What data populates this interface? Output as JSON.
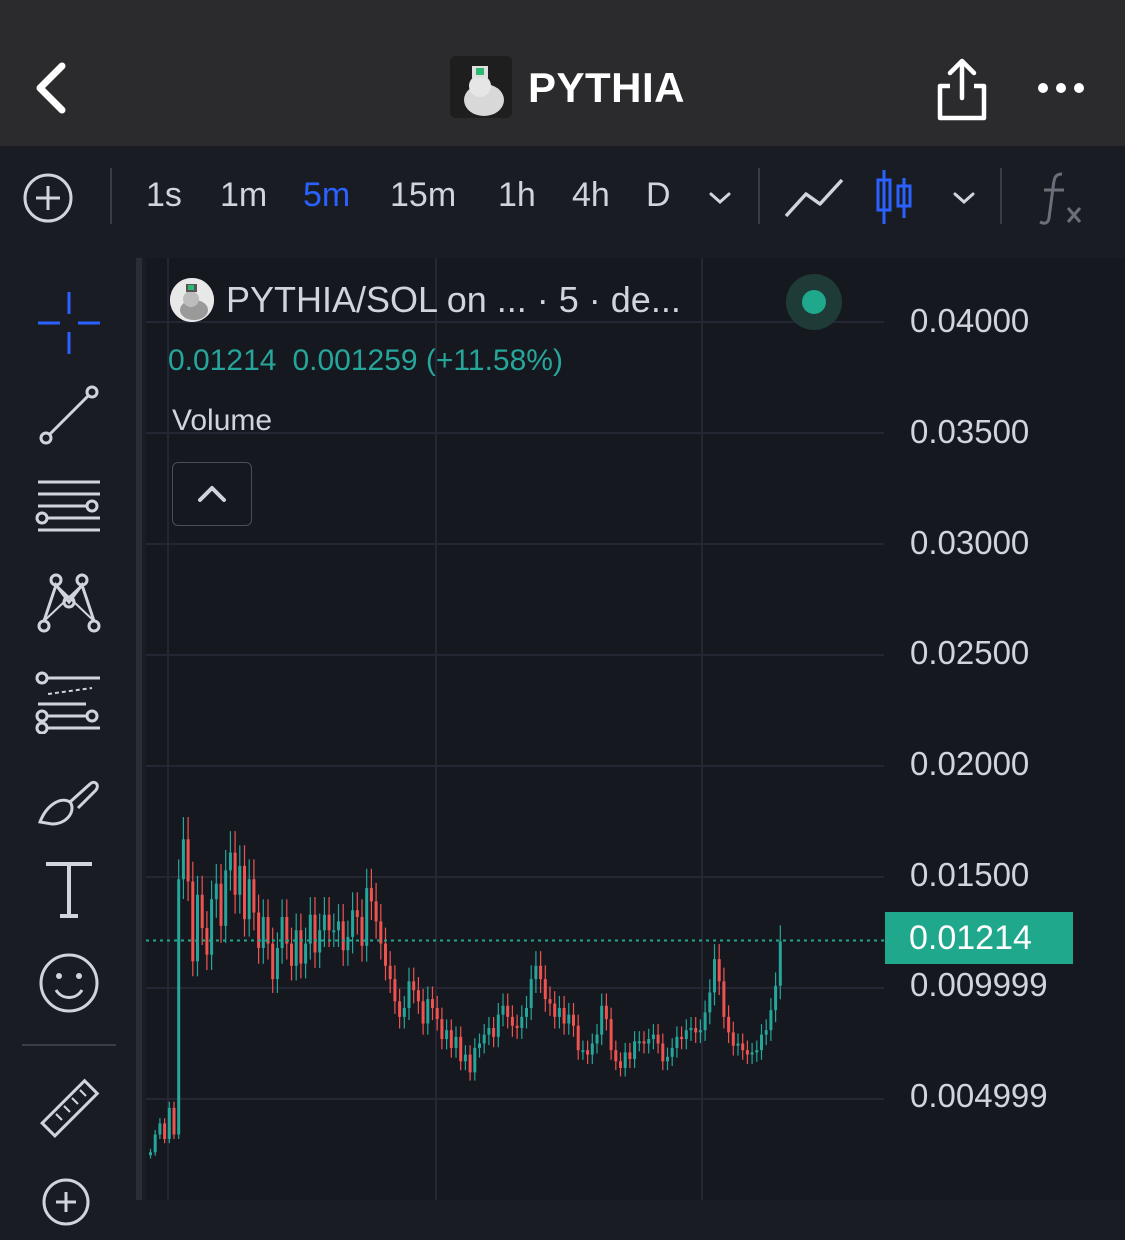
{
  "header": {
    "title": "PYTHIA",
    "back_icon": "chevron-left-icon",
    "share_icon": "share-icon",
    "more_icon": "more-horizontal-icon"
  },
  "toolbar": {
    "add_icon": "plus-circle-icon",
    "intervals": [
      "1s",
      "1m",
      "5m",
      "15m",
      "1h",
      "4h",
      "D"
    ],
    "active_interval": "5m",
    "line_chart_icon": "line-chart-icon",
    "candle_chart_icon": "candlestick-icon",
    "indicators_icon": "fx-icon"
  },
  "sidebar": {
    "tools": [
      "crosshair-icon",
      "trend-line-icon",
      "horizontal-lines-icon",
      "pattern-icon",
      "fib-icon",
      "brush-icon",
      "text-icon",
      "emoji-icon",
      "ruler-icon",
      "zoom-in-icon"
    ]
  },
  "chart_header": {
    "symbol": "PYTHIA/SOL on ... · 5 · de...",
    "last_price": "0.01214",
    "change": "0.001259 (+11.58%)",
    "volume_label": "Volume"
  },
  "yaxis": {
    "labels": [
      "0.04000",
      "0.03500",
      "0.03000",
      "0.02500",
      "0.02000",
      "0.01500",
      "0.009999",
      "0.004999"
    ],
    "current_price": "0.01214"
  },
  "colors": {
    "up": "#26a69a",
    "down": "#ef5350",
    "accent": "#2962ff",
    "price_line": "#1fa88c"
  },
  "chart_data": {
    "type": "candlestick",
    "ylim": [
      0,
      0.041
    ],
    "last_price": 0.01214,
    "closes": [
      0.0026,
      0.0034,
      0.0039,
      0.0032,
      0.0046,
      0.0034,
      0.0149,
      0.0167,
      0.0148,
      0.0112,
      0.0142,
      0.0127,
      0.0115,
      0.014,
      0.0147,
      0.0128,
      0.0153,
      0.0161,
      0.0142,
      0.0155,
      0.0131,
      0.0149,
      0.0134,
      0.0118,
      0.0132,
      0.012,
      0.0104,
      0.0118,
      0.0132,
      0.012,
      0.011,
      0.0126,
      0.0111,
      0.012,
      0.0133,
      0.0116,
      0.0126,
      0.0133,
      0.0126,
      0.0126,
      0.013,
      0.0117,
      0.0123,
      0.0135,
      0.0132,
      0.0119,
      0.0145,
      0.0139,
      0.013,
      0.012,
      0.011,
      0.0104,
      0.0094,
      0.0087,
      0.0091,
      0.0103,
      0.0099,
      0.0094,
      0.0084,
      0.0095,
      0.0091,
      0.0086,
      0.0077,
      0.0081,
      0.0073,
      0.0078,
      0.0067,
      0.007,
      0.0062,
      0.0073,
      0.0075,
      0.0079,
      0.0082,
      0.0078,
      0.0088,
      0.0092,
      0.0087,
      0.0083,
      0.0082,
      0.0087,
      0.0091,
      0.0104,
      0.011,
      0.0104,
      0.0095,
      0.0093,
      0.0087,
      0.0091,
      0.0084,
      0.0088,
      0.0083,
      0.0072,
      0.0072,
      0.007,
      0.0075,
      0.0079,
      0.0092,
      0.0086,
      0.0072,
      0.0067,
      0.0064,
      0.0071,
      0.0068,
      0.0076,
      0.0076,
      0.0075,
      0.0077,
      0.0079,
      0.0075,
      0.0067,
      0.0069,
      0.0073,
      0.0078,
      0.0077,
      0.0081,
      0.0082,
      0.008,
      0.0081,
      0.0089,
      0.0098,
      0.0113,
      0.0103,
      0.0087,
      0.008,
      0.0074,
      0.0075,
      0.0072,
      0.007,
      0.0071,
      0.0072,
      0.0079,
      0.0081,
      0.009,
      0.0101,
      0.0121
    ]
  }
}
